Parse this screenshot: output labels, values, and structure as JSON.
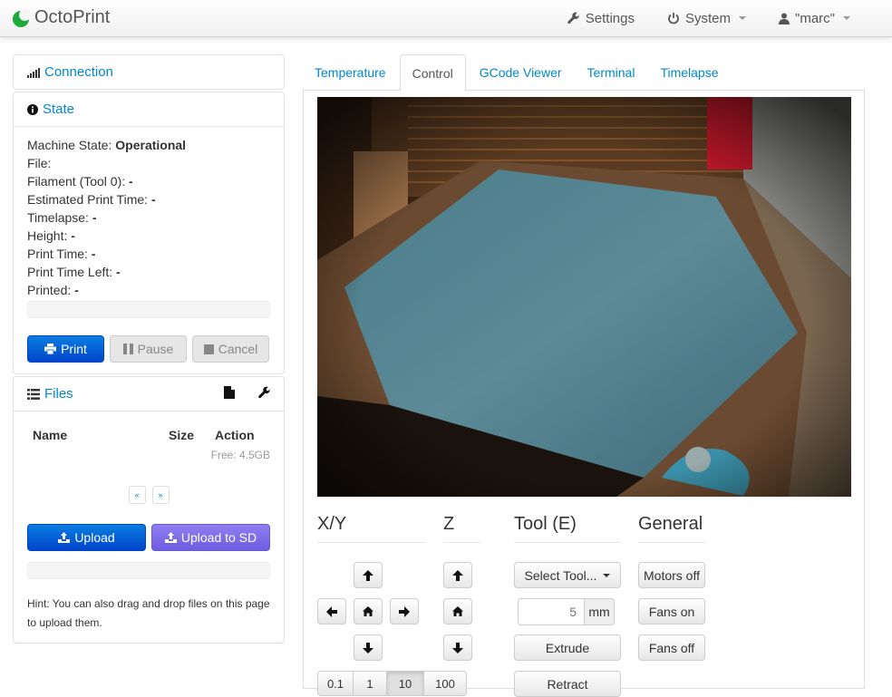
{
  "nav": {
    "brand": "OctoPrint",
    "settings": "Settings",
    "system": "System",
    "user": "\"marc\""
  },
  "sidebar": {
    "connection": {
      "title": "Connection"
    },
    "state": {
      "title": "State",
      "lines": [
        {
          "label": "Machine State:",
          "value": "Operational"
        },
        {
          "label": "File:",
          "value": ""
        },
        {
          "label": "Filament (Tool 0):",
          "value": "-"
        },
        {
          "label": "Estimated Print Time:",
          "value": "-"
        },
        {
          "label": "Timelapse:",
          "value": "-"
        },
        {
          "label": "Height:",
          "value": "-"
        },
        {
          "label": "Print Time:",
          "value": "-"
        },
        {
          "label": "Print Time Left:",
          "value": "-"
        },
        {
          "label": "Printed:",
          "value": "-"
        }
      ],
      "buttons": {
        "print": "Print",
        "pause": "Pause",
        "cancel": "Cancel"
      }
    },
    "files": {
      "title": "Files",
      "columns": {
        "name": "Name",
        "size": "Size",
        "action": "Action"
      },
      "free": "Free: 4.5GB",
      "pager": {
        "prev": "«",
        "next": "»"
      },
      "upload": "Upload",
      "upload_sd": "Upload to SD",
      "hint": "Hint: You can also drag and drop files on this page to upload them."
    }
  },
  "tabs": [
    "Temperature",
    "Control",
    "GCode Viewer",
    "Terminal",
    "Timelapse"
  ],
  "active_tab": "Control",
  "control": {
    "headers": {
      "xy": "X/Y",
      "z": "Z",
      "tool": "Tool (E)",
      "general": "General"
    },
    "tool": {
      "select": "Select Tool...",
      "amount": "5",
      "unit": "mm",
      "extrude": "Extrude",
      "retract": "Retract"
    },
    "general": {
      "motors_off": "Motors off",
      "fans_on": "Fans on",
      "fans_off": "Fans off"
    },
    "steps": [
      "0.1",
      "1",
      "10",
      "100"
    ],
    "active_step": "10"
  },
  "colors": {
    "link": "#0088cc",
    "primary": "#0044cc",
    "upload_sd": "#7b68ee",
    "brand_green": "#1fa83b"
  }
}
